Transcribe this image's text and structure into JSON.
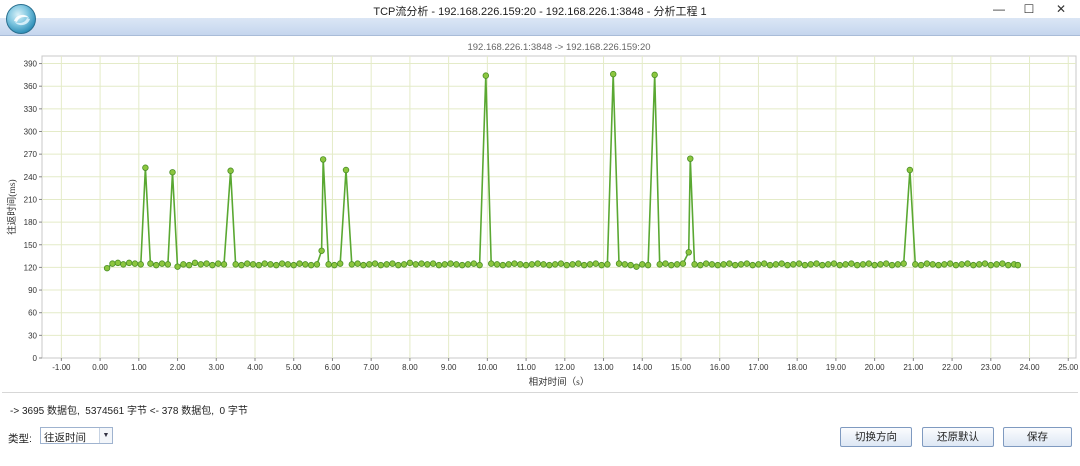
{
  "window": {
    "title": "TCP流分析 - 192.168.226.159:20 - 192.168.226.1:3848 - 分析工程 1",
    "minimize_glyph": "—",
    "maximize_glyph": "☐",
    "close_glyph": "✕"
  },
  "chart_data": {
    "type": "line",
    "title": "192.168.226.1:3848 -> 192.168.226.159:20",
    "xlabel": "相对时间（s）",
    "ylabel": "往返时间(ms)",
    "xlim": [
      -1.5,
      25.2
    ],
    "ylim": [
      0,
      400
    ],
    "x_ticks": [
      -1,
      0,
      1,
      2,
      3,
      4,
      5,
      6,
      7,
      8,
      9,
      10,
      11,
      12,
      13,
      14,
      15,
      16,
      17,
      18,
      19,
      20,
      21,
      22,
      23,
      24,
      25
    ],
    "x_tick_labels": [
      "-1.00",
      "0.00",
      "1.00",
      "2.00",
      "3.00",
      "4.00",
      "5.00",
      "6.00",
      "7.00",
      "8.00",
      "9.00",
      "10.00",
      "11.00",
      "12.00",
      "13.00",
      "14.00",
      "15.00",
      "16.00",
      "17.00",
      "18.00",
      "19.00",
      "20.00",
      "21.00",
      "22.00",
      "23.00",
      "24.00",
      "25.00"
    ],
    "y_ticks": [
      0,
      30,
      60,
      90,
      120,
      150,
      180,
      210,
      240,
      270,
      300,
      330,
      360,
      390
    ],
    "grid": true,
    "legend": "none",
    "line_color": "#5aa832",
    "marker_fill": "#8cc63f",
    "series": [
      {
        "x": [
          0.18,
          0.32,
          0.46,
          0.6,
          0.75,
          0.9,
          1.05,
          1.17,
          1.3,
          1.45,
          1.6,
          1.75,
          1.87,
          2.0,
          2.15,
          2.3,
          2.45,
          2.6,
          2.75,
          2.9,
          3.05,
          3.2,
          3.37,
          3.5,
          3.65,
          3.8,
          3.95,
          4.1,
          4.25,
          4.4,
          4.55,
          4.7,
          4.85,
          5.0,
          5.15,
          5.3,
          5.45,
          5.6,
          5.72,
          5.76,
          5.9,
          6.05,
          6.2,
          6.35,
          6.5,
          6.65,
          6.8,
          6.95,
          7.1,
          7.25,
          7.4,
          7.55,
          7.7,
          7.85,
          8.0,
          8.15,
          8.3,
          8.45,
          8.6,
          8.75,
          8.9,
          9.05,
          9.2,
          9.35,
          9.5,
          9.65,
          9.8,
          9.96,
          10.1,
          10.25,
          10.4,
          10.55,
          10.7,
          10.85,
          11.0,
          11.15,
          11.3,
          11.45,
          11.6,
          11.75,
          11.9,
          12.05,
          12.2,
          12.35,
          12.5,
          12.65,
          12.8,
          12.95,
          13.1,
          13.25,
          13.4,
          13.55,
          13.7,
          13.85,
          14.0,
          14.15,
          14.32,
          14.45,
          14.6,
          14.75,
          14.9,
          15.05,
          15.2,
          15.24,
          15.35,
          15.5,
          15.65,
          15.8,
          15.95,
          16.1,
          16.25,
          16.4,
          16.55,
          16.7,
          16.85,
          17.0,
          17.15,
          17.3,
          17.45,
          17.6,
          17.75,
          17.9,
          18.05,
          18.2,
          18.35,
          18.5,
          18.65,
          18.8,
          18.95,
          19.1,
          19.25,
          19.4,
          19.55,
          19.7,
          19.85,
          20.0,
          20.15,
          20.3,
          20.45,
          20.6,
          20.75,
          20.91,
          21.05,
          21.2,
          21.35,
          21.5,
          21.65,
          21.8,
          21.95,
          22.1,
          22.25,
          22.4,
          22.55,
          22.7,
          22.85,
          23.0,
          23.15,
          23.3,
          23.45,
          23.6,
          23.7
        ],
        "y": [
          119,
          125,
          126,
          124,
          126,
          125,
          124,
          252,
          125,
          123,
          125,
          124,
          246,
          121,
          124,
          123,
          126,
          124,
          125,
          123,
          125,
          124,
          248,
          124,
          123,
          125,
          124,
          123,
          125,
          124,
          123,
          125,
          124,
          123,
          125,
          124,
          123,
          124,
          142,
          263,
          124,
          123,
          125,
          249,
          124,
          125,
          123,
          124,
          125,
          123,
          124,
          125,
          123,
          124,
          126,
          124,
          125,
          124,
          125,
          123,
          124,
          125,
          124,
          123,
          124,
          125,
          123,
          374,
          125,
          124,
          123,
          124,
          125,
          124,
          123,
          124,
          125,
          124,
          123,
          124,
          125,
          123,
          124,
          125,
          123,
          124,
          125,
          123,
          124,
          376,
          125,
          124,
          123,
          121,
          124,
          123,
          375,
          124,
          125,
          123,
          124,
          125,
          140,
          264,
          124,
          123,
          125,
          124,
          123,
          124,
          125,
          123,
          124,
          125,
          123,
          124,
          125,
          123,
          124,
          125,
          123,
          124,
          125,
          123,
          124,
          125,
          123,
          124,
          125,
          123,
          124,
          125,
          123,
          124,
          125,
          123,
          124,
          125,
          123,
          124,
          125,
          249,
          124,
          123,
          125,
          124,
          123,
          124,
          125,
          123,
          124,
          125,
          123,
          124,
          125,
          123,
          124,
          125,
          123,
          124,
          123
        ]
      }
    ]
  },
  "stats": {
    "text": "-> 3695 数据包,  5374561 字节 <- 378 数据包,  0 字节"
  },
  "controls": {
    "type_label": "类型:",
    "type_value": "往返时间",
    "switch_label": "切换方向",
    "restore_label": "还原默认",
    "save_label": "保存"
  }
}
